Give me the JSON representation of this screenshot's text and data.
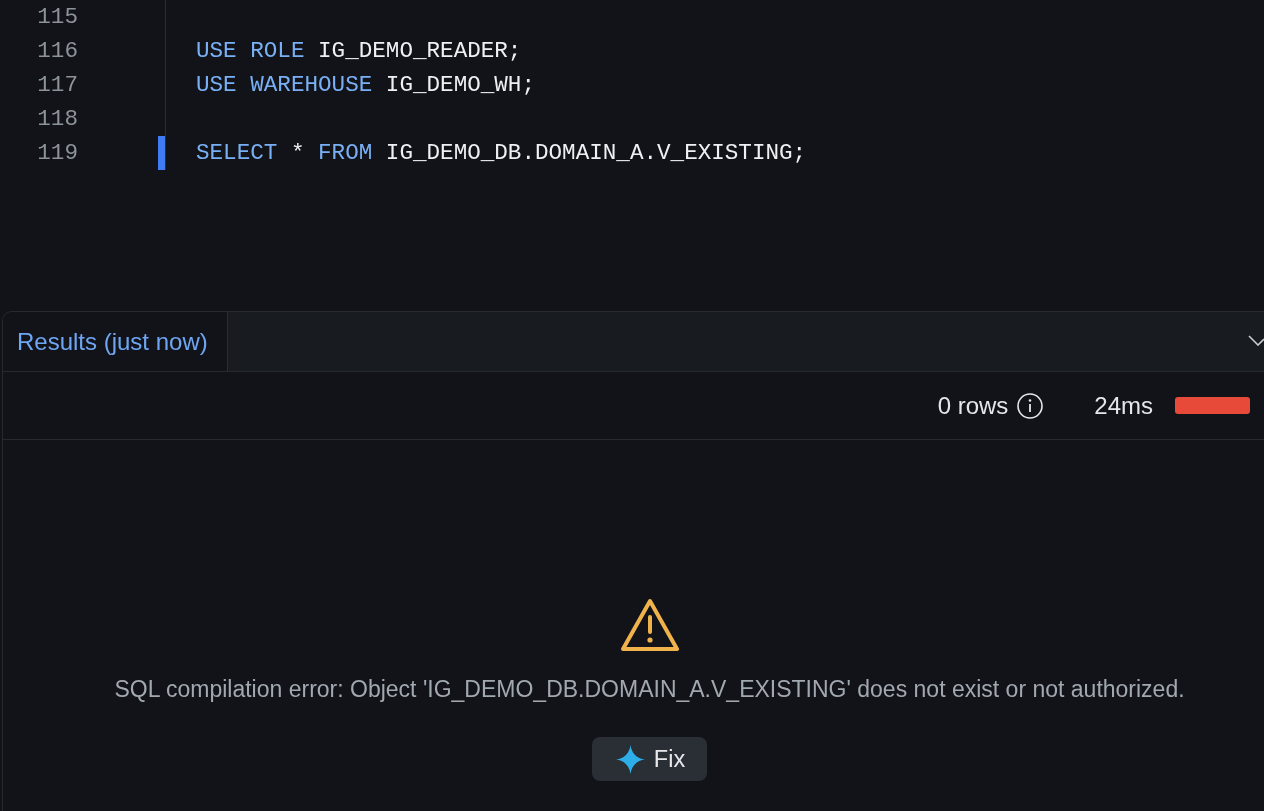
{
  "editor": {
    "lines": [
      {
        "number": "115",
        "current": false
      },
      {
        "number": "116",
        "current": false,
        "tokens": [
          {
            "text": "USE",
            "kind": "keyword"
          },
          {
            "text": "ROLE",
            "kind": "keyword"
          },
          {
            "text": "IG_DEMO_READER;",
            "kind": "identifier"
          }
        ]
      },
      {
        "number": "117",
        "current": false,
        "tokens": [
          {
            "text": "USE",
            "kind": "keyword"
          },
          {
            "text": "WAREHOUSE",
            "kind": "keyword"
          },
          {
            "text": "IG_DEMO_WH;",
            "kind": "identifier"
          }
        ]
      },
      {
        "number": "118",
        "current": false
      },
      {
        "number": "119",
        "current": true,
        "tokens": [
          {
            "text": "SELECT",
            "kind": "keyword"
          },
          {
            "text": "*",
            "kind": "operator"
          },
          {
            "text": "FROM",
            "kind": "keyword"
          },
          {
            "text": "IG_DEMO_DB.DOMAIN_A.V_EXISTING;",
            "kind": "identifier"
          }
        ]
      }
    ]
  },
  "results": {
    "tabs": [
      {
        "label": "Results (just now)",
        "selected": true
      }
    ],
    "row_count": "0 rows",
    "duration": "24ms",
    "failed": true,
    "error": {
      "message": "SQL compilation error: Object 'IG_DEMO_DB.DOMAIN_A.V_EXISTING' does not exist or not authorized.",
      "fix_button": "Fix"
    }
  }
}
